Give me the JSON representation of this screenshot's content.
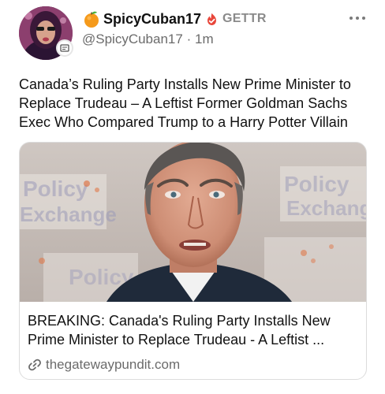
{
  "author": {
    "display_name": "SpicyCuban17",
    "platform": "GETTR",
    "handle": "@SpicyCuban17",
    "separator": "·",
    "time": "1m"
  },
  "post": {
    "text": "Canada’s Ruling Party Installs New Prime Minister to Replace Trudeau – A Leftist Former Goldman Sachs Exec Who Compared Trump to a Harry Potter Villain"
  },
  "link_card": {
    "title": "BREAKING: Canada's Ruling Party Installs New Prime Minister to Replace Trudeau - A Leftist ...",
    "domain": "thegatewaypundit.com",
    "background_text": [
      "Policy",
      "Exchange"
    ]
  },
  "icons": {
    "name_emoji": "orange-emoji",
    "verified": "verified-badge-icon",
    "more": "more-options-icon",
    "link": "link-icon",
    "avatar_badge": "avatar-badge-icon"
  },
  "colors": {
    "verified": "#e8473b",
    "muted_text": "#6b6b6b",
    "text": "#111111"
  }
}
